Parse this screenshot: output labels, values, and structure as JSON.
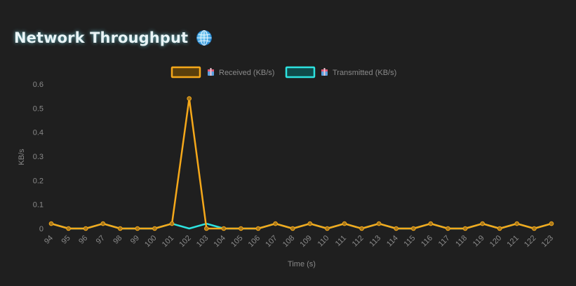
{
  "panel": {
    "title": "Network Throughput",
    "title_icon": "globe-icon"
  },
  "colors": {
    "background": "#1f1f1f",
    "received": "#f5a81a",
    "transmitted": "#2de3e0",
    "text": "#8a8a8a",
    "title": "#e9f4f6"
  },
  "chart_data": {
    "type": "line",
    "title": "",
    "xlabel": "Time (s)",
    "ylabel": "KB/s",
    "ylim": [
      0,
      0.6
    ],
    "yticks": [
      "0",
      "0.1",
      "0.2",
      "0.3",
      "0.4",
      "0.5",
      "0.6"
    ],
    "x": [
      "94",
      "95",
      "96",
      "97",
      "98",
      "99",
      "100",
      "101",
      "102",
      "103",
      "104",
      "105",
      "106",
      "107",
      "108",
      "109",
      "110",
      "111",
      "112",
      "113",
      "114",
      "115",
      "116",
      "117",
      "118",
      "119",
      "120",
      "121",
      "122",
      "123"
    ],
    "grid": false,
    "legend_position": "top-center",
    "series": [
      {
        "name": "Received (KB/s)",
        "color": "#f5a81a",
        "values": [
          0.02,
          0,
          0,
          0.02,
          0,
          0,
          0,
          0.02,
          0.54,
          0,
          0,
          0,
          0,
          0.02,
          0,
          0.02,
          0,
          0.02,
          0,
          0.02,
          0,
          0,
          0.02,
          0,
          0,
          0.02,
          0,
          0.02,
          0,
          0.02
        ]
      },
      {
        "name": "Transmitted (KB/s)",
        "color": "#2de3e0",
        "values": [
          0.02,
          0,
          0,
          0.02,
          0,
          0,
          0,
          0.02,
          0,
          0.02,
          0,
          0,
          0,
          0.02,
          0,
          0.02,
          0,
          0.02,
          0,
          0.02,
          0,
          0,
          0.02,
          0,
          0,
          0.02,
          0,
          0.02,
          0,
          0.02
        ]
      }
    ]
  }
}
